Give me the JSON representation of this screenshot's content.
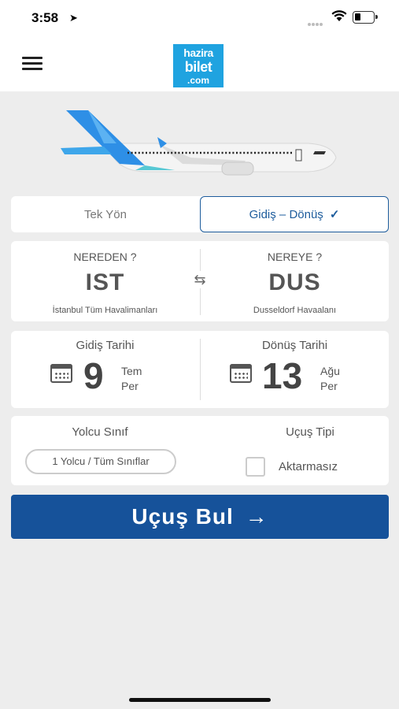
{
  "status_bar": {
    "time": "3:58",
    "location_icon": "➤"
  },
  "header": {
    "menu_icon": "hamburger-icon",
    "logo": {
      "line1": "hazira",
      "line2": "bilet",
      "line3": ".com",
      "color": "#1fa3e0"
    }
  },
  "trip_type": {
    "one_way": "Tek Yön",
    "round_trip": "Gidiş – Dönüş",
    "round_trip_check": "✓",
    "selected": "round_trip"
  },
  "route": {
    "from_label": "NEREDEN ?",
    "from_code": "IST",
    "from_airport": "İstanbul Tüm Havalimanları",
    "to_label": "NEREYE ?",
    "to_code": "DUS",
    "to_airport": "Dusseldorf Havaalanı",
    "swap_icon": "⇆"
  },
  "dates": {
    "departure_label": "Gidiş Tarihi",
    "departure_day": "9",
    "departure_month": "Tem",
    "departure_weekday": "Per",
    "return_label": "Dönüş Tarihi",
    "return_day": "13",
    "return_month": "Ağu",
    "return_weekday": "Per"
  },
  "passenger": {
    "label": "Yolcu Sınıf",
    "value": "1 Yolcu / Tüm Sınıflar",
    "flight_type_label": "Uçuş Tipi",
    "nonstop_label": "Aktarmasız",
    "nonstop_checked": false
  },
  "search_button": {
    "label": "Uçuş Bul",
    "arrow": "→",
    "color": "#16529a"
  },
  "colors": {
    "accent": "#1d5c9c",
    "background": "#ededed"
  }
}
